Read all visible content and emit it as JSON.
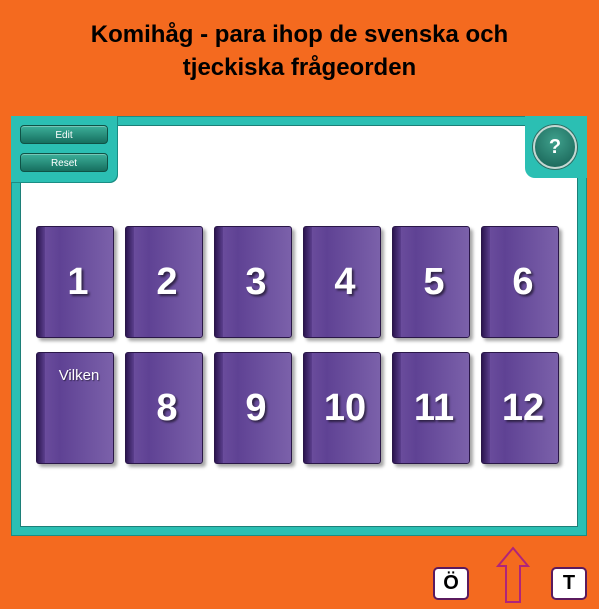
{
  "title": {
    "line1": "Komihåg - para ihop de svenska och",
    "line2": "tjeckiska frågeorden"
  },
  "toolbar": {
    "edit_label": "Edit",
    "reset_label": "Reset",
    "help_label": "?"
  },
  "cards": [
    {
      "label": "1"
    },
    {
      "label": "2"
    },
    {
      "label": "3"
    },
    {
      "label": "4"
    },
    {
      "label": "5"
    },
    {
      "label": "6"
    },
    {
      "label": "Vilken",
      "revealed": true
    },
    {
      "label": "8"
    },
    {
      "label": "9"
    },
    {
      "label": "10"
    },
    {
      "label": "11"
    },
    {
      "label": "12"
    }
  ],
  "footer": {
    "left_button_label": "Ö",
    "right_button_label": "T",
    "arrow_icon": "up-arrow-icon"
  },
  "colors": {
    "background": "#f46a1f",
    "board_frame": "#2bbfb3",
    "card": "#6a4c9c",
    "arrow": "#b0247a"
  }
}
